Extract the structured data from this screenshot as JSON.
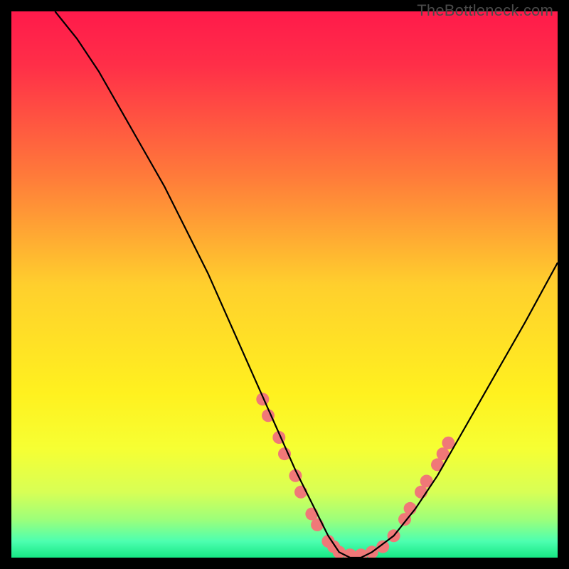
{
  "watermark": "TheBottleneck.com",
  "chart_data": {
    "type": "line",
    "title": "",
    "xlabel": "",
    "ylabel": "",
    "xlim": [
      0,
      100
    ],
    "ylim": [
      0,
      100
    ],
    "grid": false,
    "legend": false,
    "background_gradient": {
      "stops": [
        {
          "offset": 0.0,
          "color": "#ff1a4b"
        },
        {
          "offset": 0.1,
          "color": "#ff2f48"
        },
        {
          "offset": 0.3,
          "color": "#ff7a3a"
        },
        {
          "offset": 0.5,
          "color": "#ffcf2d"
        },
        {
          "offset": 0.7,
          "color": "#fff11f"
        },
        {
          "offset": 0.8,
          "color": "#f6ff33"
        },
        {
          "offset": 0.88,
          "color": "#d8ff55"
        },
        {
          "offset": 0.93,
          "color": "#9dff7a"
        },
        {
          "offset": 0.97,
          "color": "#4dffb0"
        },
        {
          "offset": 1.0,
          "color": "#17e884"
        }
      ]
    },
    "series": [
      {
        "name": "bottleneck-curve",
        "color": "#000000",
        "x": [
          8,
          12,
          16,
          20,
          24,
          28,
          32,
          36,
          40,
          44,
          48,
          52,
          56,
          58,
          60,
          62,
          64,
          66,
          70,
          74,
          78,
          82,
          86,
          90,
          94,
          100
        ],
        "y": [
          100,
          95,
          89,
          82,
          75,
          68,
          60,
          52,
          43,
          34,
          25,
          16,
          8,
          4,
          1,
          0,
          0,
          1,
          4,
          9,
          15,
          22,
          29,
          36,
          43,
          54
        ]
      }
    ],
    "markers": {
      "name": "highlight-dots",
      "color": "#f07878",
      "radius": 9,
      "points": [
        {
          "x": 46,
          "y": 29
        },
        {
          "x": 47,
          "y": 26
        },
        {
          "x": 49,
          "y": 22
        },
        {
          "x": 50,
          "y": 19
        },
        {
          "x": 52,
          "y": 15
        },
        {
          "x": 53,
          "y": 12
        },
        {
          "x": 55,
          "y": 8
        },
        {
          "x": 56,
          "y": 6
        },
        {
          "x": 58,
          "y": 3
        },
        {
          "x": 59,
          "y": 2
        },
        {
          "x": 60,
          "y": 1
        },
        {
          "x": 62,
          "y": 0.5
        },
        {
          "x": 64,
          "y": 0.5
        },
        {
          "x": 66,
          "y": 1
        },
        {
          "x": 68,
          "y": 2
        },
        {
          "x": 70,
          "y": 4
        },
        {
          "x": 72,
          "y": 7
        },
        {
          "x": 73,
          "y": 9
        },
        {
          "x": 75,
          "y": 12
        },
        {
          "x": 76,
          "y": 14
        },
        {
          "x": 78,
          "y": 17
        },
        {
          "x": 79,
          "y": 19
        },
        {
          "x": 80,
          "y": 21
        }
      ]
    }
  }
}
